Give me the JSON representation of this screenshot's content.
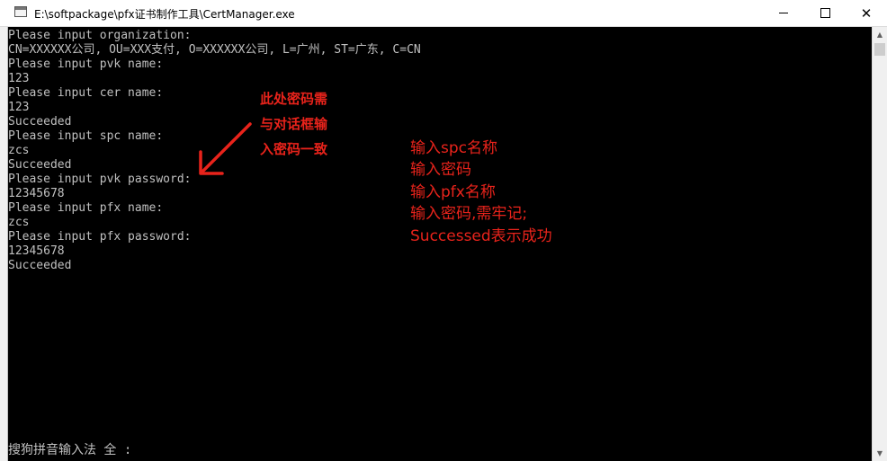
{
  "window": {
    "title": "E:\\softpackage\\pfx证书制作工具\\CertManager.exe",
    "minimize_label": "—",
    "maximize_label": "☐",
    "close_label": "✕"
  },
  "console": {
    "lines": [
      "Please input organization:",
      "CN=XXXXXX公司, OU=XXX支付, O=XXXXXX公司, L=广州, ST=广东, C=CN",
      "Please input pvk name:",
      "123",
      "Please input cer name:",
      "123",
      "Succeeded",
      "Please input spc name:",
      "zcs",
      "Succeeded",
      "Please input pvk password:",
      "12345678",
      "Please input pfx name:",
      "zcs",
      "Please input pfx password:",
      "12345678",
      "Succeeded"
    ],
    "ime_status": "搜狗拼音输入法 全 :"
  },
  "annotations": {
    "left": [
      "此处密码需",
      "与对话框输",
      "入密码一致"
    ],
    "right": [
      "输入spc名称",
      "输入密码",
      "输入pfx名称",
      "输入密码,需牢记;",
      "Successed表示成功"
    ],
    "color": "#e8231b"
  },
  "icons": {
    "app": "console-window-icon",
    "arrow": "red-arrow-icon"
  }
}
